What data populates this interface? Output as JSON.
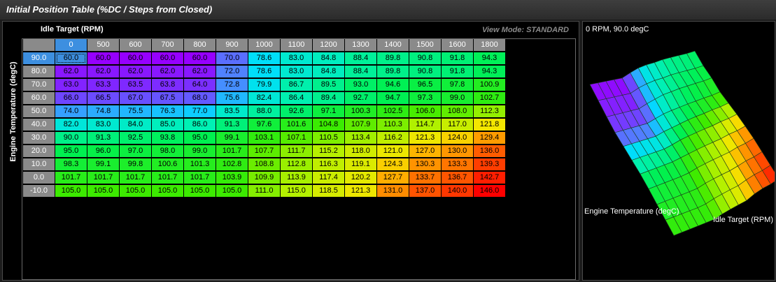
{
  "window": {
    "title": "Initial Position Table (%DC / Steps from Closed)"
  },
  "table": {
    "x_axis_label": "Idle Target (RPM)",
    "y_axis_label": "Engine Temperature (degC)",
    "view_mode": "View Mode: STANDARD",
    "columns": [
      "0",
      "500",
      "600",
      "700",
      "800",
      "900",
      "1000",
      "1100",
      "1200",
      "1300",
      "1400",
      "1500",
      "1600",
      "1800"
    ],
    "rows": [
      {
        "label": "90.0",
        "values": [
          "60.0",
          "60.0",
          "60.0",
          "60.0",
          "60.0",
          "70.0",
          "78.6",
          "83.0",
          "84.8",
          "88.4",
          "89.8",
          "90.8",
          "91.8",
          "94.3"
        ]
      },
      {
        "label": "80.0",
        "values": [
          "62.0",
          "62.0",
          "62.0",
          "62.0",
          "62.0",
          "72.0",
          "78.6",
          "83.0",
          "84.8",
          "88.4",
          "89.8",
          "90.8",
          "91.8",
          "94.3"
        ]
      },
      {
        "label": "70.0",
        "values": [
          "63.0",
          "63.3",
          "63.5",
          "63.8",
          "64.0",
          "72.8",
          "79.9",
          "86.7",
          "89.5",
          "93.0",
          "94.6",
          "96.5",
          "97.8",
          "100.9"
        ]
      },
      {
        "label": "60.0",
        "values": [
          "66.0",
          "66.5",
          "67.0",
          "67.5",
          "68.0",
          "75.6",
          "82.4",
          "86.4",
          "89.4",
          "92.7",
          "94.7",
          "97.3",
          "99.0",
          "102.7"
        ]
      },
      {
        "label": "50.0",
        "values": [
          "74.0",
          "74.8",
          "75.5",
          "76.3",
          "77.0",
          "83.5",
          "88.0",
          "92.6",
          "97.1",
          "100.3",
          "102.5",
          "106.0",
          "108.0",
          "112.3"
        ]
      },
      {
        "label": "40.0",
        "values": [
          "82.0",
          "83.0",
          "84.0",
          "85.0",
          "86.0",
          "91.3",
          "97.6",
          "101.6",
          "104.8",
          "107.9",
          "110.3",
          "114.7",
          "117.0",
          "121.8"
        ]
      },
      {
        "label": "30.0",
        "values": [
          "90.0",
          "91.3",
          "92.5",
          "93.8",
          "95.0",
          "99.1",
          "103.1",
          "107.1",
          "110.5",
          "113.4",
          "116.2",
          "121.3",
          "124.0",
          "129.4"
        ]
      },
      {
        "label": "20.0",
        "values": [
          "95.0",
          "96.0",
          "97.0",
          "98.0",
          "99.0",
          "101.7",
          "107.7",
          "111.7",
          "115.2",
          "118.0",
          "121.0",
          "127.0",
          "130.0",
          "136.0"
        ]
      },
      {
        "label": "10.0",
        "values": [
          "98.3",
          "99.1",
          "99.8",
          "100.6",
          "101.3",
          "102.8",
          "108.8",
          "112.8",
          "116.3",
          "119.1",
          "124.3",
          "130.3",
          "133.3",
          "139.3"
        ]
      },
      {
        "label": "0.0",
        "values": [
          "101.7",
          "101.7",
          "101.7",
          "101.7",
          "101.7",
          "103.9",
          "109.9",
          "113.9",
          "117.4",
          "120.2",
          "127.7",
          "133.7",
          "136.7",
          "142.7"
        ]
      },
      {
        "label": "-10.0",
        "values": [
          "105.0",
          "105.0",
          "105.0",
          "105.0",
          "105.0",
          "105.0",
          "111.0",
          "115.0",
          "118.5",
          "121.3",
          "131.0",
          "137.0",
          "140.0",
          "146.0"
        ]
      }
    ],
    "selected": {
      "row": 0,
      "col": 0
    },
    "colors": {
      "header_gray": "#8a8a8a",
      "selected_blue": "#3d8fe0"
    }
  },
  "plot": {
    "cursor_readout": "0 RPM, 90.0 degC",
    "y_axis_label": "Engine Temperature (degC)",
    "x_axis_label": "Idle Target (RPM)"
  }
}
